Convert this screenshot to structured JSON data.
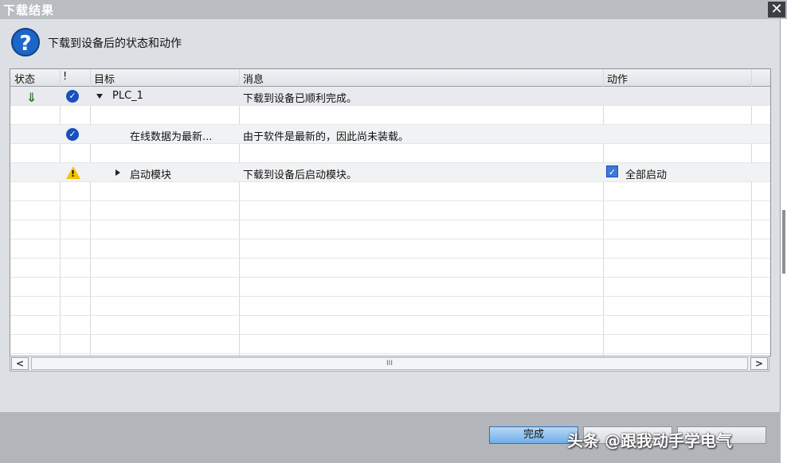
{
  "window": {
    "title": "下载结果",
    "close_label": "✕"
  },
  "header": {
    "text": "下载到设备后的状态和动作"
  },
  "table": {
    "columns": [
      "状态",
      "!",
      "目标",
      "消息",
      "动作"
    ],
    "rows": [
      {
        "target": "PLC_1",
        "message": "下载到设备已顺利完成。",
        "action": ""
      },
      {
        "target": "在线数据为最新...",
        "message": "由于软件是最新的，因此尚未装载。",
        "action": ""
      },
      {
        "target": "启动模块",
        "message": "下载到设备后启动模块。",
        "action": "全部启动"
      }
    ]
  },
  "scrollbar": {
    "left": "<",
    "right": ">",
    "thumb": "III"
  },
  "footer": {
    "done_label": "完成"
  },
  "watermark": "头条 @跟我动手学电气",
  "colors": {
    "accent": "#1a4fbf",
    "warning": "#f4c400",
    "done_button": "#6faee9"
  }
}
